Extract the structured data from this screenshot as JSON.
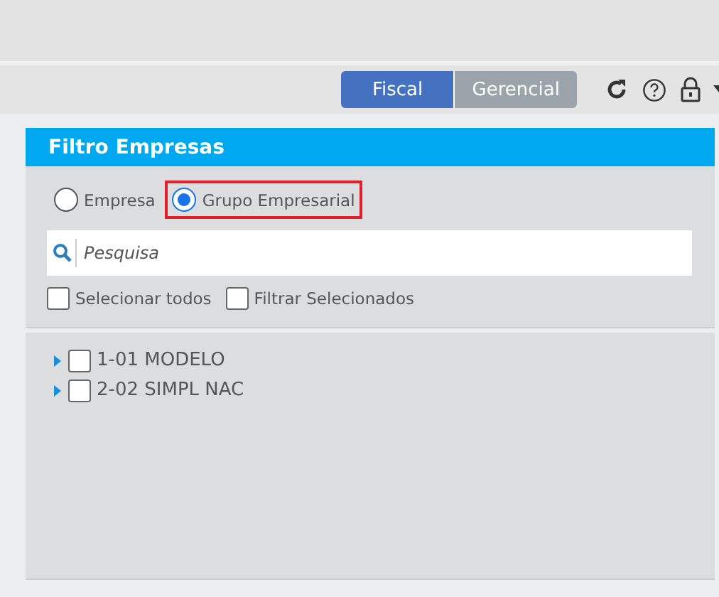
{
  "toolbar": {
    "view_tabs": [
      {
        "label": "Fiscal",
        "selected": true
      },
      {
        "label": "Gerencial",
        "selected": false
      }
    ]
  },
  "panel": {
    "title": "Filtro Empresas",
    "radios": [
      {
        "label": "Empresa",
        "selected": false,
        "highlighted": false
      },
      {
        "label": "Grupo Empresarial",
        "selected": true,
        "highlighted": true
      }
    ],
    "search": {
      "placeholder": "Pesquisa"
    },
    "options": [
      {
        "label": "Selecionar todos",
        "checked": false
      },
      {
        "label": "Filtrar Selecionados",
        "checked": false
      }
    ],
    "tree": [
      {
        "label": "1-01 MODELO",
        "checked": false,
        "expanded": false
      },
      {
        "label": "2-02 SIMPL NAC",
        "checked": false,
        "expanded": false
      }
    ]
  }
}
